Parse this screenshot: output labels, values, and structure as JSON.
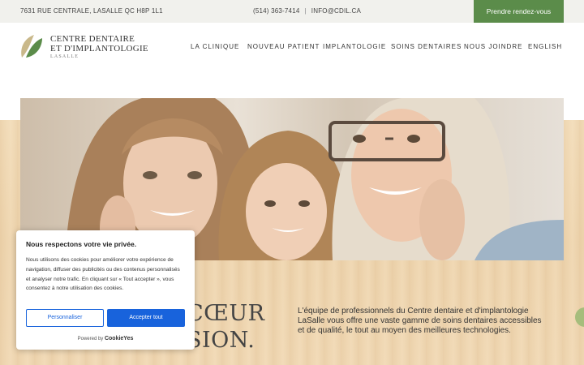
{
  "topbar": {
    "address": "7631 RUE CENTRALE, LASALLE QC H8P 1L1",
    "phone": "(514) 363-7414",
    "separator": "|",
    "email": "INFO@CDIL.CA",
    "cta_label": "Prendre rendez-vous"
  },
  "logo": {
    "line1": "CENTRE DENTAIRE",
    "line2": "ET D'IMPLANTOLOGIE",
    "line3": "LASALLE",
    "colors": {
      "dark": "#5b8c4a",
      "light": "#c9b88a"
    }
  },
  "nav": [
    {
      "label": "LA CLINIQUE"
    },
    {
      "label": "NOUVEAU PATIENT"
    },
    {
      "label": "IMPLANTOLOGIE"
    },
    {
      "label": "SOINS DENTAIRES"
    },
    {
      "label": "NOUS JOINDRE"
    },
    {
      "label": "ENGLISH"
    }
  ],
  "hero": {
    "headline_line1": "CŒUR",
    "headline_line2": "SION.",
    "intro": "L'équipe de professionnels du Centre dentaire et d'implantologie LaSalle vous offre une vaste gamme de soins dentaires accessibles et de qualité, le tout au moyen des meilleures technologies."
  },
  "cookie": {
    "title": "Nous respectons votre vie privée.",
    "body": "Nous utilisons des cookies pour améliorer votre expérience de navigation, diffuser des publicités ou des contenus personnalisés et analyser notre trafic. En cliquant sur « Tout accepter », vous consentez à notre utilisation des cookies.",
    "customize_label": "Personnaliser",
    "accept_label": "Accepter tout",
    "powered_by": "Powered by",
    "brand": "CookieYes"
  },
  "colors": {
    "accent_green": "#5b8c4a",
    "cookie_blue": "#1863dc",
    "float_button": "#a6bd7c"
  }
}
